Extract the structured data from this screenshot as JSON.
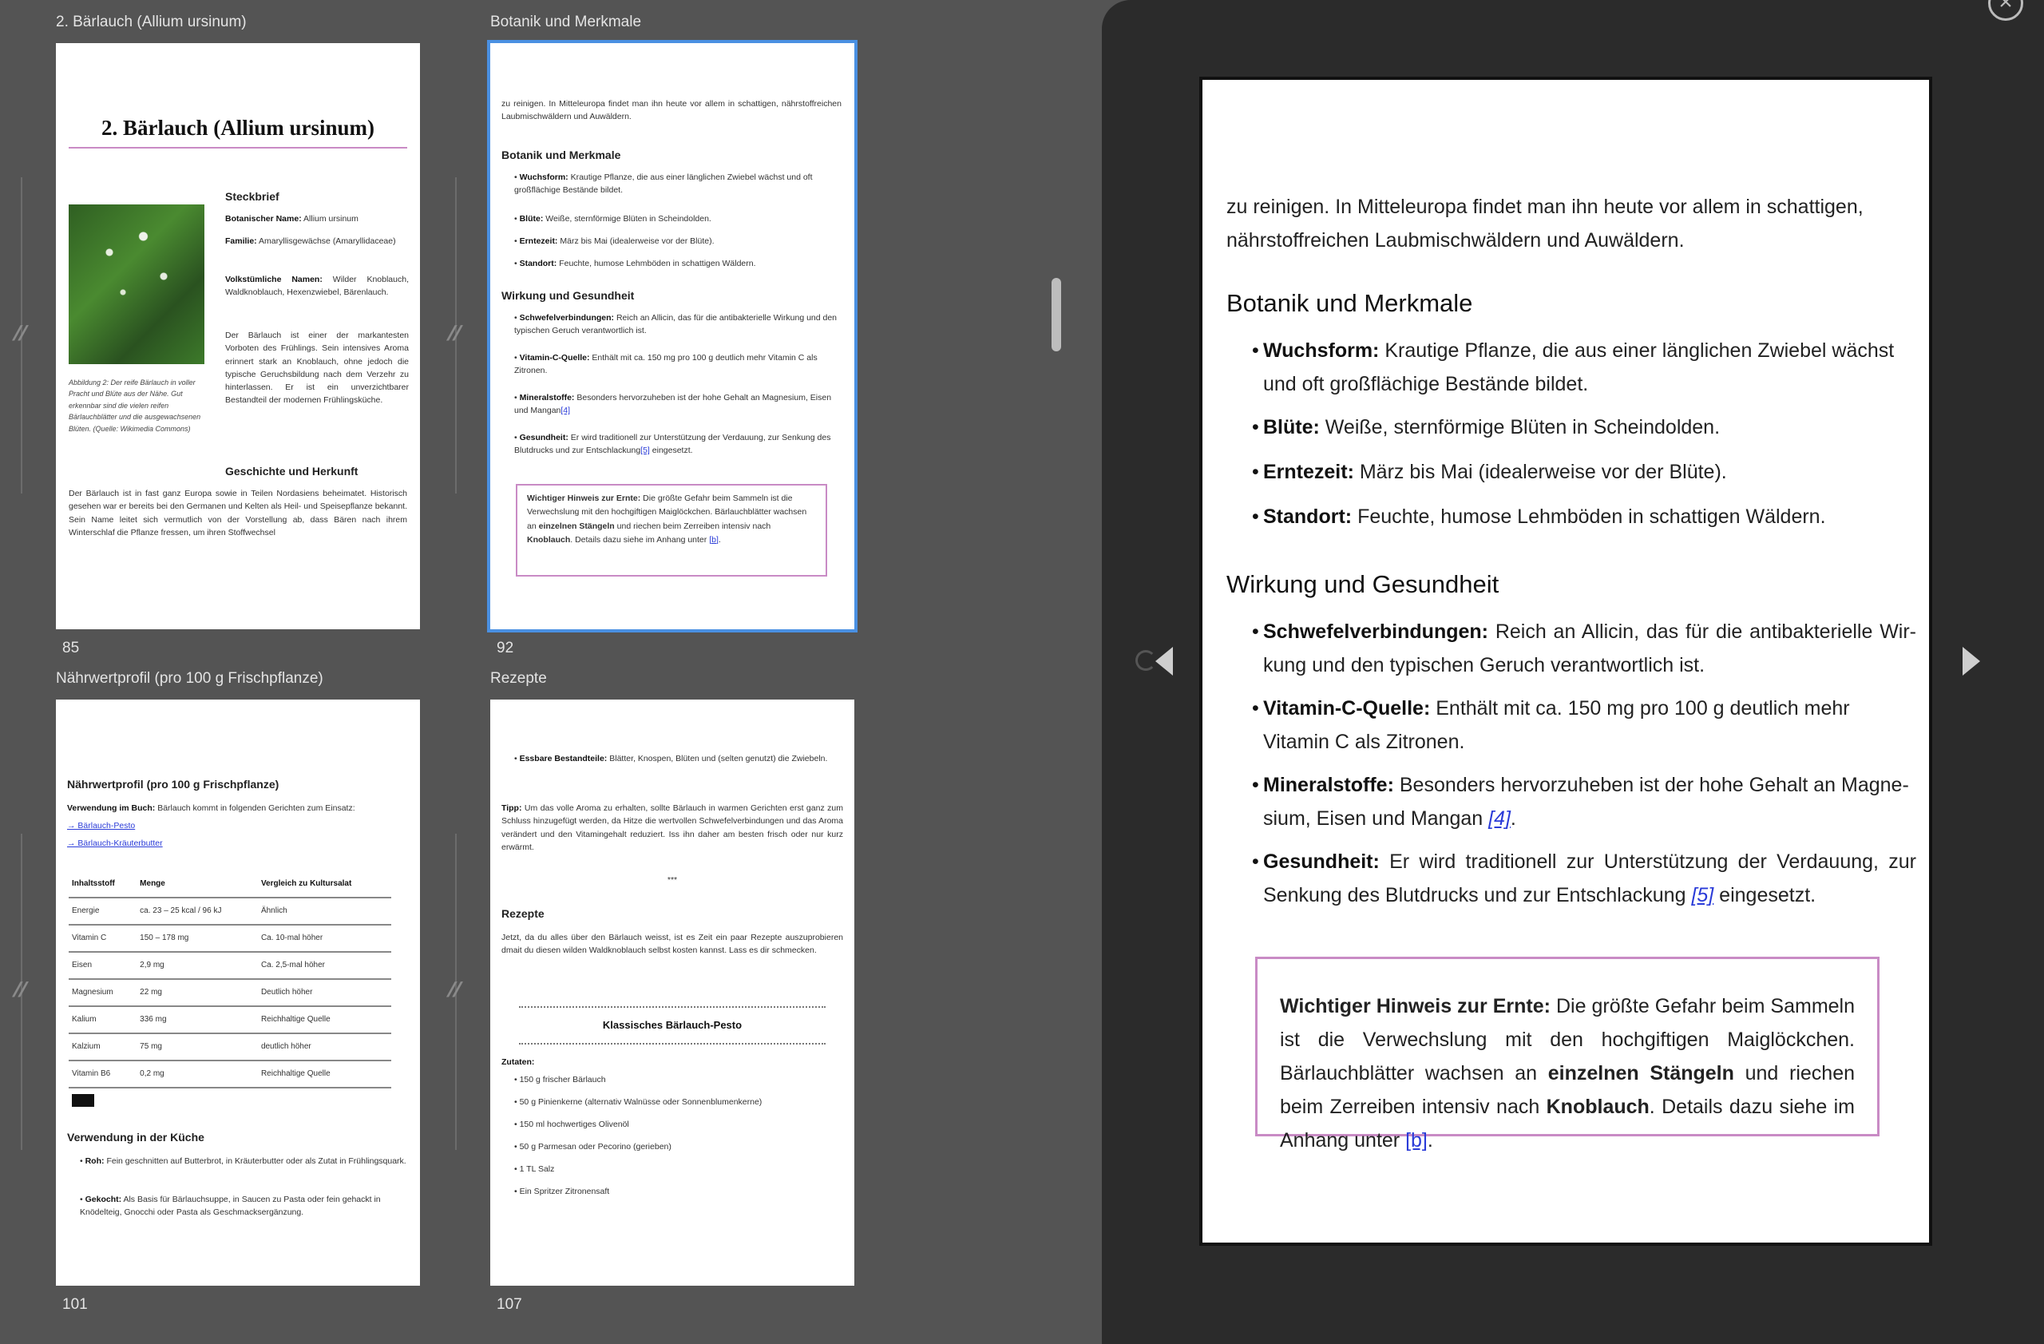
{
  "grid": {
    "cells": [
      {
        "title": "2. Bärlauch (Allium ursinum)",
        "page": "85"
      },
      {
        "title": "Botanik und Merkmale",
        "page": "92"
      },
      {
        "title": "Nährwertprofil (pro 100 g Frischpflanze)",
        "page": "101"
      },
      {
        "title": "Rezepte",
        "page": "107"
      }
    ]
  },
  "thumb85": {
    "heading": "2. Bärlauch (Allium ursinum)",
    "steckbrief": "Steckbrief",
    "botname_label": "Botanischer Name:",
    "botname": "Allium ursinum",
    "familie_label": "Familie:",
    "familie": "Amaryllisgewächse (Amarylli­daceae)",
    "volk_label": "Volkstümliche Namen:",
    "volk": "Wilder Knoblauch, Waldknoblauch, Hexenzwiebel, Bären­lauch.",
    "intro": "Der Bärlauch ist einer der markantesten Vorboten des Frühlings. Sein intensives Aroma erinnert stark an Knoblauch, ohne jedoch die typische Geruchsbildung nach dem Verzehr zu hinterlassen. Er ist ein un­verzichtbarer Bestandteil der modernen Frühlingsküche.",
    "caption": "Abbildung 2: Der reife Bärlauch in voller Pracht und Blüte aus der Nähe. Gut erkennbar sind die vielen reifen Bärlauchblätter und die ausgewach­senen Blüten. (Quelle: Wikimedia Commons)",
    "geschichte": "Geschichte und Herkunft",
    "geschichte_text": "Der Bärlauch ist in fast ganz Europa sowie in Teilen Nordasiens beheimatet. Historisch gesehen war er bereits bei den Germanen und Kelten als Heil- und Speisepflanze bekannt. Sein Name leitet sich vermutlich von der Vorstellung ab, dass Bären nach ihrem Winterschlaf die Pflanze fressen, um ihren Stoffwechsel"
  },
  "thumb92": {
    "intro": "zu reinigen. In Mitteleuropa findet man ihn heute vor allem in schattigen, nähr­stoffreichen Laubmischwäldern und Auwäldern.",
    "h_botanik": "Botanik und Merkmale",
    "wuchsform_label": "Wuchsform:",
    "wuchsform": "Krautige Pflanze, die aus einer länglichen Zwiebel wächst und oft großflächige Bestände bildet.",
    "bluete_label": "Blüte:",
    "bluete": "Weiße, sternförmige Blüten in Scheindolden.",
    "erntezeit_label": "Erntezeit:",
    "erntezeit": "März bis Mai (idealerweise vor der Blüte).",
    "standort_label": "Standort:",
    "standort": "Feuchte, humose Lehmböden in schattigen Wäldern.",
    "h_wirkung": "Wirkung und Gesundheit",
    "schwefel_label": "Schwefelverbindungen:",
    "schwefel": "Reich an Allicin, das für die antibakterielle Wir­kung und den typischen Geruch verantwortlich ist.",
    "vitc_label": "Vitamin-C-Quelle:",
    "vitc": "Enthält mit ca. 150 mg pro 100 g deutlich mehr Vitamin C als Zitronen.",
    "mineral_label": "Mineralstoffe:",
    "mineral": "Besonders hervorzuheben ist der hohe Gehalt an Magne­sium, Eisen und Mangan",
    "mineral_ref": "[4]",
    "gesund_label": "Gesundheit:",
    "gesund": "Er wird traditionell zur Unterstützung der Verdauung, zur Senkung des Blutdrucks und zur Entschlackung",
    "gesund_ref": "[5]",
    "gesund_end": " eingesetzt.",
    "note_label": "Wichtiger Hinweis zur Ernte:",
    "note_a": " Die größte Gefahr beim Sammeln ist die Verwechslung mit den hochgiftigen Maiglöckchen. Bärlauch­blätter wachsen an ",
    "note_b": "einzelnen Stängeln",
    "note_c": " und riechen beim Zerreiben intensiv nach ",
    "note_d": "Knoblauch",
    "note_e": ". Details dazu siehe im Anhang unter ",
    "note_ref": "[b]",
    "note_end": "."
  },
  "thumb101": {
    "heading": "Nährwertprofil (pro 100 g Frischpflanze)",
    "verwendung_label": "Verwendung im Buch:",
    "verwendung": "Bärlauch kommt in folgenden Gerichten zum Einsatz:",
    "link1": "→ Bärlauch-Pesto",
    "link2": "→ Bärlauch-Kräuterbutter",
    "table_head": [
      "Inhaltsstoff",
      "Menge",
      "Vergleich zu Kultursalat"
    ],
    "table_rows": [
      [
        "Energie",
        "ca. 23 – 25 kcal / 96 kJ",
        "Ähnlich"
      ],
      [
        "Vitamin C",
        "150 – 178 mg",
        "Ca. 10-mal höher"
      ],
      [
        "Eisen",
        "2,9 mg",
        "Ca. 2,5-mal höher"
      ],
      [
        "Magnesium",
        "22 mg",
        "Deutlich höher"
      ],
      [
        "Kalium",
        "336 mg",
        "Reichhaltige Quelle"
      ],
      [
        "Kalzium",
        "75 mg",
        "deutlich höher"
      ],
      [
        "Vitamin B6",
        "0,2 mg",
        "Reichhaltige Quelle"
      ]
    ],
    "h_kueche": "Verwendung in der Küche",
    "roh_label": "Roh:",
    "roh": "Fein geschnitten auf Butterbrot, in Kräuterbutter oder als Zutat in Frühlingsquark.",
    "gekocht_label": "Gekocht:",
    "gekocht": "Als Basis für Bärlauchsuppe, in Saucen zu Pasta oder fein ge­hackt in Knödelteig, Gnocchi oder Pasta als Geschmacksergänzung."
  },
  "thumb107": {
    "essbar_label": "Essbare Bestandteile:",
    "essbar": "Blätter, Knospen, Blüten und (selten genutzt) die Zwiebeln.",
    "tipp_label": "Tipp:",
    "tipp": "Um das volle Aroma zu erhalten, sollte Bärlauch in warmen Gerichten erst ganz zum Schluss hinzugefügt werden, da Hitze die wertvollen Schwefelver­bindungen und das Aroma verändert und den Vitamingehalt reduziert. Iss ihn daher am besten frisch oder nur kurz erwärmt.",
    "stars": "***",
    "h_rezepte": "Rezepte",
    "rezepte_text": "Jetzt, da du alles über den Bärlauch weisst, ist es Zeit ein paar Rezepte auszu­probieren dmait du diesen wilden Waldknoblauch selbst kosten kannst. Lass es dir schmecken.",
    "rezept_title": "Klassisches Bärlauch-Pesto",
    "zutaten": "Zutaten:",
    "items": [
      "150 g frischer Bärlauch",
      "50 g Pinienkerne (alternativ Walnüsse oder Sonnenblumenkerne)",
      "150 ml hochwertiges Olivenöl",
      "50 g Parmesan oder Pecorino (gerieben)",
      "1 TL Salz",
      "Ein Spritzer Zitronensaft"
    ]
  },
  "viewer": {
    "close_icon": "×",
    "bullet": "•"
  },
  "colors": {
    "selection": "#4a90e2",
    "note_border": "#c98bc5",
    "link": "#2a3bd8"
  }
}
